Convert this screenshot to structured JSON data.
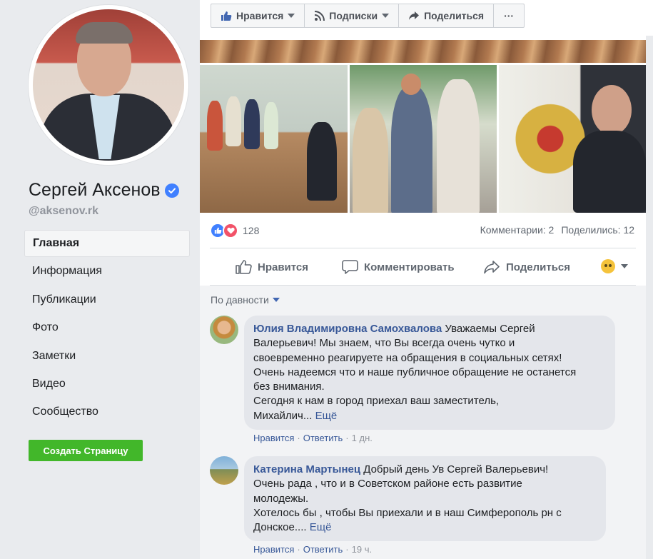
{
  "page": {
    "name": "Сергей Аксенов",
    "handle": "@aksenov.rk"
  },
  "nav": {
    "items": [
      {
        "label": "Главная"
      },
      {
        "label": "Информация"
      },
      {
        "label": "Публикации"
      },
      {
        "label": "Фото"
      },
      {
        "label": "Заметки"
      },
      {
        "label": "Видео"
      },
      {
        "label": "Сообщество"
      }
    ],
    "create_page_label": "Создать Страницу"
  },
  "actionbar": {
    "like_label": "Нравится",
    "follow_label": "Подписки",
    "share_label": "Поделиться",
    "more_label": "···"
  },
  "post": {
    "reactions_count": "128",
    "comments_count": "Комментарии: 2",
    "shares_count": "Поделились: 12",
    "actions": {
      "like": "Нравится",
      "comment": "Комментировать",
      "share": "Поделиться"
    },
    "sort_label": "По давности"
  },
  "comments": [
    {
      "author": "Юлия Владимировна Самохвалова",
      "lines": [
        " Уважаемы Сергей",
        "Валерьевич! Мы знаем, что Вы всегда очень чутко и",
        "своевременно реагируете на обращения в социальных сетях!",
        "Очень надеемся что и наше публичное обращение не останется",
        "без внимания.",
        "Сегодня к нам в город приехал ваш заместитель,",
        "Михайлич..."
      ],
      "more": "Ещё",
      "like": "Нравится",
      "reply": "Ответить",
      "time": "1 дн."
    },
    {
      "author": "Катерина Мартынец",
      "lines": [
        " Добрый день Ув Сергей Валерьевич!",
        "Очень рада , что и в Советском районе есть развитие",
        "молодежы.",
        "Хотелось бы , чтобы Вы приехали и в наш Симферополь рн с",
        "Донское...."
      ],
      "more": "Ещё",
      "like": "Нравится",
      "reply": "Ответить",
      "time": "19 ч."
    }
  ],
  "colors": {
    "facebook_blue": "#4267b2",
    "link": "#385898",
    "green_button": "#42b72a",
    "background": "#e9ebee"
  }
}
